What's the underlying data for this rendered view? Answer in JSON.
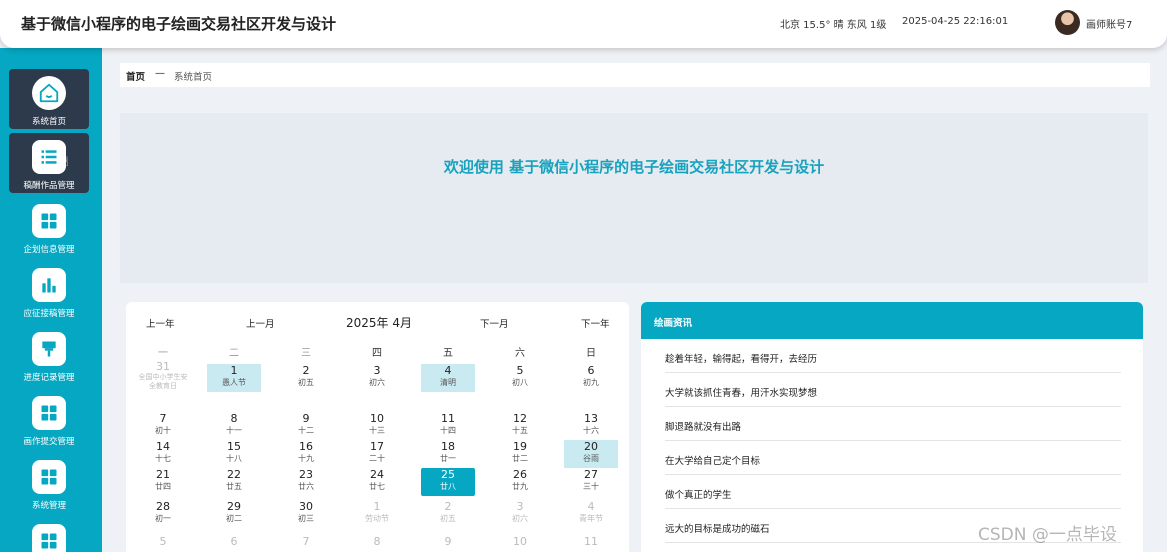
{
  "header": {
    "app_title": "基于微信小程序的电子绘画交易社区开发与设计",
    "weather": "北京  15.5°  晴  东风  1级",
    "datetime": "2025-04-25 22:16:01",
    "username": "画师账号7"
  },
  "sidebar": {
    "items": [
      {
        "label": "系统首页",
        "icon": "home-icon"
      },
      {
        "label": "稿酬作品管理",
        "icon": "list-icon"
      },
      {
        "label": "企划信息管理",
        "icon": "grid-icon"
      },
      {
        "label": "应征接稿管理",
        "icon": "bar-chart-icon"
      },
      {
        "label": "进度记录管理",
        "icon": "pin-icon"
      },
      {
        "label": "画作提交管理",
        "icon": "grid-icon"
      },
      {
        "label": "系统管理",
        "icon": "grid-icon"
      }
    ]
  },
  "breadcrumb": {
    "home": "首页",
    "separator": "—",
    "current": "系统首页"
  },
  "welcome": {
    "text": "欢迎使用 基于微信小程序的电子绘画交易社区开发与设计"
  },
  "calendar": {
    "prev_year": "上一年",
    "prev_month": "上一月",
    "title": "2025年 4月",
    "next_month": "下一月",
    "next_year": "下一年",
    "weekdays": [
      "一",
      "二",
      "三",
      "四",
      "五",
      "六",
      "日"
    ],
    "weeks": [
      [
        {
          "num": "31",
          "sub": "全国中小学生安全教育日",
          "other": true
        },
        {
          "num": "1",
          "sub": "愚人节",
          "hl": true
        },
        {
          "num": "2",
          "sub": "初五"
        },
        {
          "num": "3",
          "sub": "初六"
        },
        {
          "num": "4",
          "sub": "清明",
          "hl": true
        },
        {
          "num": "5",
          "sub": "初八"
        },
        {
          "num": "6",
          "sub": "初九"
        }
      ],
      [
        {
          "num": "7",
          "sub": "初十"
        },
        {
          "num": "8",
          "sub": "十一"
        },
        {
          "num": "9",
          "sub": "十二"
        },
        {
          "num": "10",
          "sub": "十三"
        },
        {
          "num": "11",
          "sub": "十四"
        },
        {
          "num": "12",
          "sub": "十五"
        },
        {
          "num": "13",
          "sub": "十六"
        }
      ],
      [
        {
          "num": "14",
          "sub": "十七"
        },
        {
          "num": "15",
          "sub": "十八"
        },
        {
          "num": "16",
          "sub": "十九"
        },
        {
          "num": "17",
          "sub": "二十"
        },
        {
          "num": "18",
          "sub": "廿一"
        },
        {
          "num": "19",
          "sub": "廿二"
        },
        {
          "num": "20",
          "sub": "谷雨",
          "hl": true
        }
      ],
      [
        {
          "num": "21",
          "sub": "廿四"
        },
        {
          "num": "22",
          "sub": "廿五"
        },
        {
          "num": "23",
          "sub": "廿六"
        },
        {
          "num": "24",
          "sub": "廿七"
        },
        {
          "num": "25",
          "sub": "廿八",
          "today": true
        },
        {
          "num": "26",
          "sub": "廿九"
        },
        {
          "num": "27",
          "sub": "三十"
        }
      ],
      [
        {
          "num": "28",
          "sub": "初一"
        },
        {
          "num": "29",
          "sub": "初二"
        },
        {
          "num": "30",
          "sub": "初三"
        },
        {
          "num": "1",
          "sub": "劳动节",
          "other": true
        },
        {
          "num": "2",
          "sub": "初五",
          "other": true
        },
        {
          "num": "3",
          "sub": "初六",
          "other": true
        },
        {
          "num": "4",
          "sub": "青年节",
          "other": true
        }
      ],
      [
        {
          "num": "5",
          "sub": "",
          "other": true
        },
        {
          "num": "6",
          "sub": "",
          "other": true
        },
        {
          "num": "7",
          "sub": "",
          "other": true
        },
        {
          "num": "8",
          "sub": "",
          "other": true
        },
        {
          "num": "9",
          "sub": "",
          "other": true
        },
        {
          "num": "10",
          "sub": "",
          "other": true
        },
        {
          "num": "11",
          "sub": "",
          "other": true
        }
      ]
    ]
  },
  "news": {
    "title": "绘画资讯",
    "items": [
      "趁着年轻，输得起，看得开，去经历",
      "大学就该抓住青春，用汗水实现梦想",
      "脚退路就没有出路",
      "在大学给自己定个目标",
      "做个真正的学生",
      "远大的目标是成功的磁石"
    ]
  },
  "watermark": "CSDN @一点毕设",
  "colors": {
    "accent": "#05a7c2",
    "sidebar_active": "#2d3a4b",
    "welcome_text": "#17a2bd",
    "highlight": "#c9eaf1"
  }
}
